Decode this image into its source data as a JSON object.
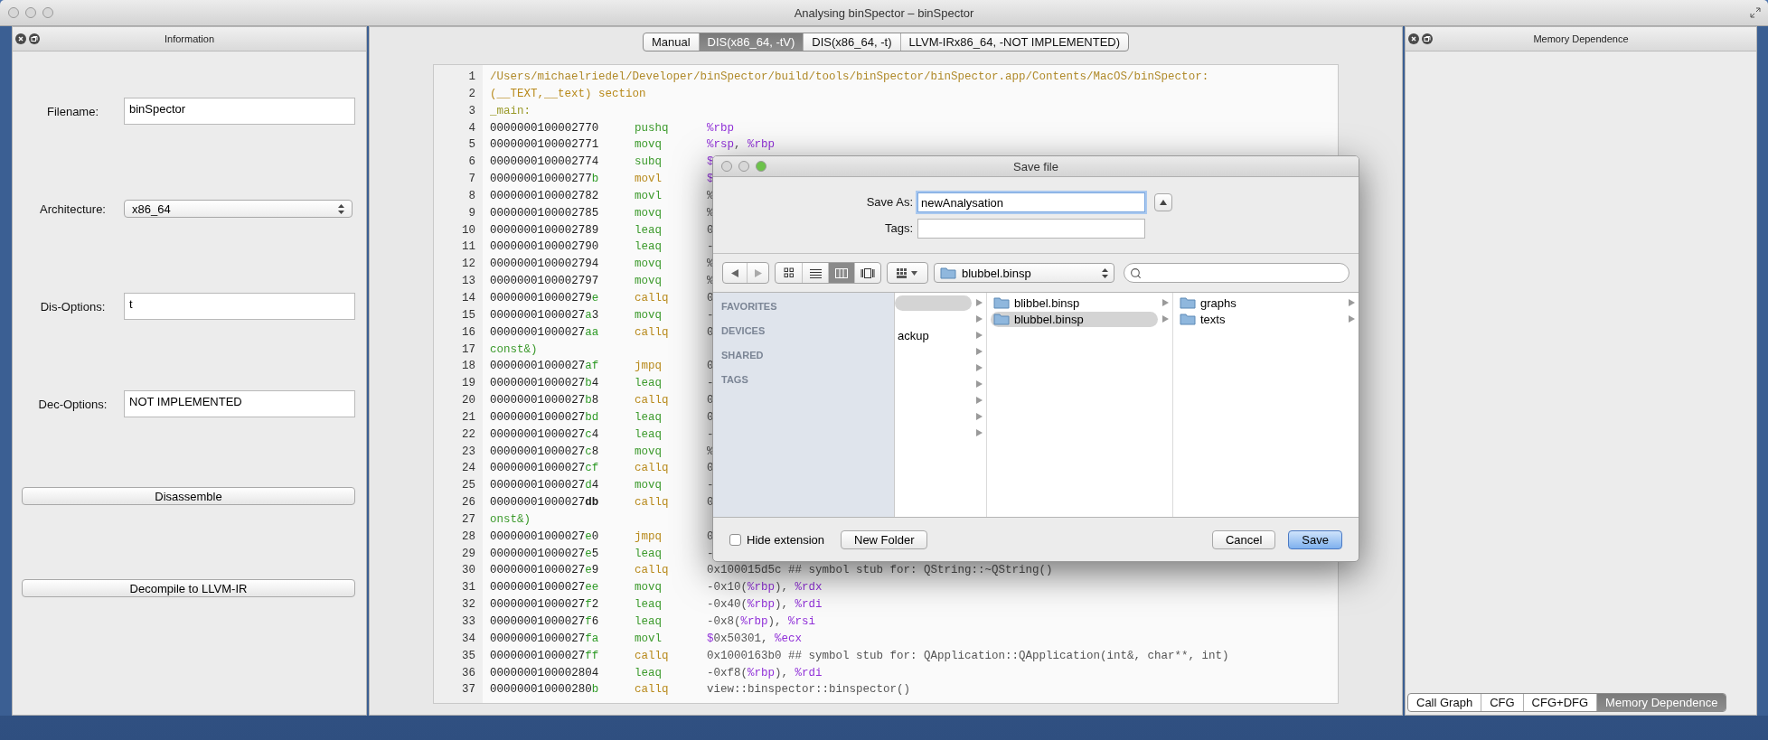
{
  "window": {
    "title": "Analysing binSpector – binSpector"
  },
  "info_panel": {
    "title": "Information",
    "fields": [
      {
        "kind": "text",
        "label": "Filename:",
        "value": "binSpector"
      },
      {
        "kind": "select",
        "label": "Architecture:",
        "value": "x86_64"
      },
      {
        "kind": "text",
        "label": "Dis-Options:",
        "value": "t"
      },
      {
        "kind": "text",
        "label": "Dec-Options:",
        "value": "NOT IMPLEMENTED"
      }
    ],
    "buttons": [
      "Disassemble",
      "Decompile to LLVM-IR"
    ]
  },
  "view_tabs": [
    {
      "label": "Manual",
      "selected": false
    },
    {
      "label": "DIS(x86_64, -tV)",
      "selected": true
    },
    {
      "label": "DIS(x86_64, -t)",
      "selected": false
    },
    {
      "label": "LLVM-IRx86_64, -NOT IMPLEMENTED)",
      "selected": false
    }
  ],
  "code": [
    {
      "num": "1",
      "kind": "path",
      "text": "/Users/michaelriedel/Developer/binSpector/build/tools/binSpector/binSpector.app/Contents/MacOS/binSpector:"
    },
    {
      "num": "2",
      "kind": "section",
      "text": "(__TEXT,__text) section"
    },
    {
      "num": "3",
      "kind": "label",
      "text": "_main:"
    },
    {
      "num": "4",
      "kind": "asm",
      "addr": "0000000100002770",
      "op": "pushq",
      "color": "#3c9a2c",
      "args": "%rbp"
    },
    {
      "num": "5",
      "kind": "asm",
      "addr": "0000000100002771",
      "op": "movq",
      "color": "#3c9a2c",
      "args": "%rsp, %rbp"
    },
    {
      "num": "6",
      "kind": "asm",
      "addr": "0000000100002774",
      "op": "subq",
      "color": "#3c9a2c",
      "args": "$"
    },
    {
      "num": "7",
      "kind": "asm",
      "addr": "000000010000277b",
      "op": "movl",
      "color": "#b88a1c",
      "args": "$"
    },
    {
      "num": "8",
      "kind": "asm",
      "addr": "0000000100002782",
      "op": "movl",
      "color": "#3c9a2c",
      "args": "%"
    },
    {
      "num": "9",
      "kind": "asm",
      "addr": "0000000100002785",
      "op": "movq",
      "color": "#3c9a2c",
      "args": "%"
    },
    {
      "num": "10",
      "kind": "asm",
      "addr": "0000000100002789",
      "op": "leaq",
      "color": "#3c9a2c",
      "args": "0"
    },
    {
      "num": "11",
      "kind": "asm",
      "addr": "0000000100002790",
      "op": "leaq",
      "color": "#3c9a2c",
      "args": "-"
    },
    {
      "num": "12",
      "kind": "asm",
      "addr": "0000000100002794",
      "op": "movq",
      "color": "#3c9a2c",
      "args": "%"
    },
    {
      "num": "13",
      "kind": "asm",
      "addr": "0000000100002797",
      "op": "movq",
      "color": "#3c9a2c",
      "args": "%"
    },
    {
      "num": "14",
      "kind": "asm",
      "addr": "000000010000279e",
      "op": "callq",
      "color": "#b88a1c",
      "args": "0"
    },
    {
      "num": "15",
      "kind": "asm",
      "addr": "00000001000027a3",
      "op": "movq",
      "color": "#3c9a2c",
      "args": "-"
    },
    {
      "num": "16",
      "kind": "asm",
      "addr": "00000001000027aa",
      "op": "callq",
      "color": "#b88a1c",
      "args": "0"
    },
    {
      "num": "17",
      "kind": "wrap",
      "text": "const&)"
    },
    {
      "num": "18",
      "kind": "asm",
      "addr": "00000001000027af",
      "op": "jmpq",
      "color": "#b88a1c",
      "args": "0"
    },
    {
      "num": "19",
      "kind": "asm",
      "addr": "00000001000027b4",
      "op": "leaq",
      "color": "#3c9a2c",
      "args": "-"
    },
    {
      "num": "20",
      "kind": "asm",
      "addr": "00000001000027b8",
      "op": "callq",
      "color": "#b88a1c",
      "args": "0"
    },
    {
      "num": "21",
      "kind": "asm",
      "addr": "00000001000027bd",
      "op": "leaq",
      "color": "#3c9a2c",
      "args": "0"
    },
    {
      "num": "22",
      "kind": "asm",
      "addr": "00000001000027c4",
      "op": "leaq",
      "color": "#3c9a2c",
      "args": "-"
    },
    {
      "num": "23",
      "kind": "asm",
      "addr": "00000001000027c8",
      "op": "movq",
      "color": "#3c9a2c",
      "args": "%"
    },
    {
      "num": "24",
      "kind": "asm",
      "addr": "00000001000027cf",
      "op": "callq",
      "color": "#b88a1c",
      "args": "0"
    },
    {
      "num": "25",
      "kind": "asm",
      "addr": "00000001000027d4",
      "op": "movq",
      "color": "#3c9a2c",
      "args": "-"
    },
    {
      "num": "26",
      "kind": "asm",
      "addr": "00000001000027**db**",
      "op": "callq",
      "color": "#b88a1c",
      "args": "0"
    },
    {
      "num": "27",
      "kind": "wrap",
      "text": "onst&)"
    },
    {
      "num": "28",
      "kind": "asm",
      "addr": "00000001000027e0",
      "op": "jmpq",
      "color": "#b88a1c",
      "args": "0"
    },
    {
      "num": "29",
      "kind": "asm",
      "addr": "00000001000027e5",
      "op": "leaq",
      "color": "#3c9a2c",
      "args": "-"
    },
    {
      "num": "30",
      "kind": "asm",
      "addr": "00000001000027e9",
      "op": "callq",
      "color": "#b88a1c",
      "args": "0x100015d5c ## symbol stub for: QString::~QString()"
    },
    {
      "num": "31",
      "kind": "asm",
      "addr": "00000001000027ee",
      "op": "movq",
      "color": "#3c9a2c",
      "args": "-0x10(%rbp), %rdx"
    },
    {
      "num": "32",
      "kind": "asm",
      "addr": "00000001000027f2",
      "op": "leaq",
      "color": "#3c9a2c",
      "args": "-0x40(%rbp), %rdi"
    },
    {
      "num": "33",
      "kind": "asm",
      "addr": "00000001000027f6",
      "op": "leaq",
      "color": "#3c9a2c",
      "args": "-0x8(%rbp), %rsi"
    },
    {
      "num": "34",
      "kind": "asm",
      "addr": "00000001000027fa",
      "op": "movl",
      "color": "#3c9a2c",
      "args": "$0x50301, %ecx"
    },
    {
      "num": "35",
      "kind": "asm",
      "addr": "00000001000027ff",
      "op": "callq",
      "color": "#b88a1c",
      "args": "0x1000163b0 ## symbol stub for: QApplication::QApplication(int&, char**, int)"
    },
    {
      "num": "36",
      "kind": "asm",
      "addr": "0000000100002804",
      "op": "leaq",
      "color": "#3c9a2c",
      "args": "-0xf8(%rbp), %rdi"
    },
    {
      "num": "37",
      "kind": "asm",
      "addr": "000000010000280b",
      "op": "callq",
      "color": "#b88a1c",
      "args": "view::binspector::binspector()"
    }
  ],
  "graph_panel": {
    "title": "Memory Dependence",
    "tabs": [
      {
        "label": "Call Graph",
        "selected": false
      },
      {
        "label": "CFG",
        "selected": false
      },
      {
        "label": "CFG+DFG",
        "selected": false
      },
      {
        "label": "Memory Dependence",
        "selected": true
      }
    ]
  },
  "save_dialog": {
    "title": "Save file",
    "save_as_label": "Save As:",
    "save_as_value": "newAnalysation",
    "tags_label": "Tags:",
    "view_modes": [
      {
        "kind": "icons",
        "selected": false
      },
      {
        "kind": "list",
        "selected": false
      },
      {
        "kind": "columns",
        "selected": true
      },
      {
        "kind": "coverflow",
        "selected": false
      }
    ],
    "location": "blubbel.binsp",
    "sidebar": [
      "FAVORITES",
      "DEVICES",
      "SHARED",
      "TAGS"
    ],
    "column_1": [
      {
        "selected": true
      },
      {
        "selected": false
      },
      {
        "label": "ackup",
        "selected": false
      },
      {
        "selected": false
      },
      {
        "selected": false
      },
      {
        "selected": false
      },
      {
        "selected": false
      },
      {
        "selected": false
      },
      {
        "selected": false
      }
    ],
    "column_2": [
      {
        "label": "blibbel.binsp",
        "selected": false
      },
      {
        "label": "blubbel.binsp",
        "selected": true
      }
    ],
    "column_3": [
      {
        "label": "graphs",
        "selected": false
      },
      {
        "label": "texts",
        "selected": false
      }
    ],
    "hide_extension": {
      "label": "Hide extension",
      "checked": false
    },
    "buttons": [
      {
        "label": "New Folder",
        "kind": "plain"
      },
      {
        "label": "Cancel",
        "kind": "plain"
      },
      {
        "label": "Save",
        "kind": "default"
      }
    ]
  }
}
